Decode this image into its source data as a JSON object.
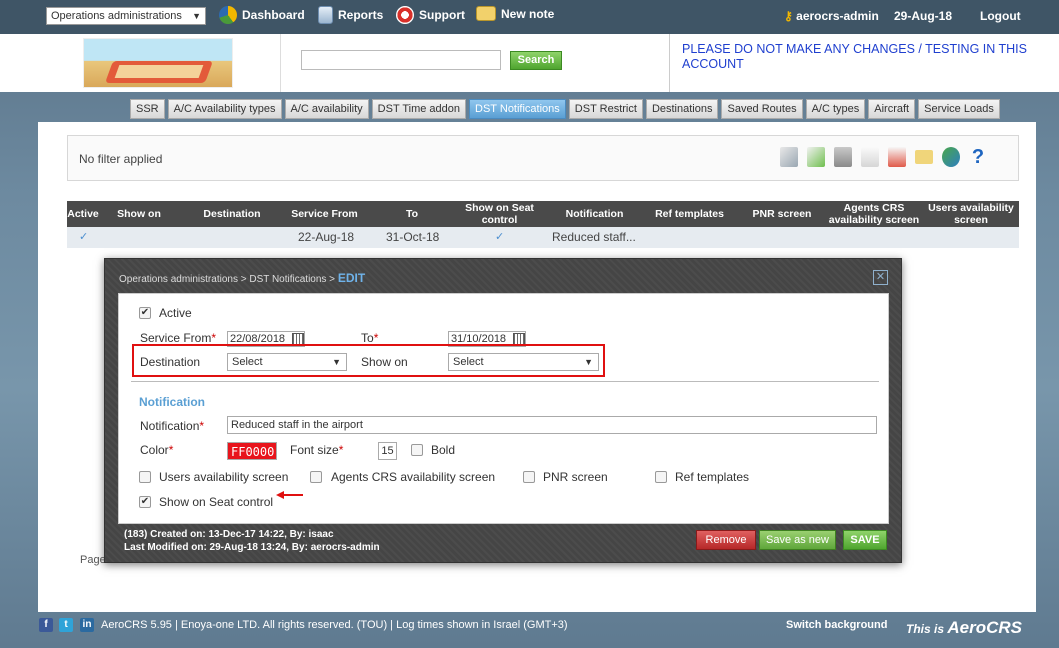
{
  "topbar": {
    "module_select": "Operations administrations",
    "dashboard": "Dashboard",
    "reports": "Reports",
    "support": "Support",
    "new_note": "New note",
    "user": "aerocrs-admin",
    "date": "29-Aug-18",
    "logout": "Logout"
  },
  "header": {
    "search_button": "Search",
    "warning": "PLEASE DO NOT MAKE ANY CHANGES / TESTING IN THIS ACCOUNT"
  },
  "tabs": [
    "SSR",
    "A/C Availability types",
    "A/C availability",
    "DST Time addon",
    "DST Notifications",
    "DST Restrict",
    "Destinations",
    "Saved Routes",
    "A/C types",
    "Aircraft",
    "Service Loads"
  ],
  "active_tab": "DST Notifications",
  "filter": {
    "text": "No filter applied",
    "help_icon": "?"
  },
  "grid": {
    "columns": [
      "Active",
      "Show on",
      "Destination",
      "Service From",
      "To",
      "Show on Seat control",
      "Notification",
      "Ref templates",
      "PNR screen",
      "Agents CRS availability screen",
      "Users availability screen"
    ],
    "rows": [
      {
        "active": "✓",
        "show_on": "",
        "destination": "",
        "service_from": "22-Aug-18",
        "to": "31-Oct-18",
        "seat_control": "✓",
        "notification": "Reduced staff..."
      }
    ]
  },
  "paging": "Page",
  "modal": {
    "breadcrumb": "Operations administrations > DST Notifications > ",
    "mode": "EDIT",
    "close": "✕",
    "active_label": "Active",
    "active_checked": "✔",
    "service_from_label": "Service From",
    "service_from_value": "22/08/2018",
    "to_label": "To",
    "to_value": "31/10/2018",
    "required_mark": "*",
    "destination_label": "Destination",
    "destination_value": "Select",
    "show_on_label": "Show on",
    "show_on_value": "Select",
    "section_title": "Notification",
    "notification_label": "Notification",
    "notification_value": "Reduced staff in the airport",
    "color_label": "Color",
    "color_value": "FF0000",
    "font_size_label": "Font size",
    "font_size_value": "15",
    "bold_label": "Bold",
    "users_avail_label": "Users availability screen",
    "agents_crs_label": "Agents CRS availability screen",
    "pnr_label": "PNR screen",
    "ref_templates_label": "Ref templates",
    "seat_control_label": "Show on Seat control",
    "seat_control_checked": "✔",
    "created": "(183) Created on: 13-Dec-17 14:22, By: isaac",
    "modified": "Last Modified on: 29-Aug-18 13:24, By: aerocrs-admin",
    "remove_button": "Remove",
    "save_as_new_button": "Save as new",
    "save_button": "SAVE"
  },
  "footer": {
    "facebook": "f",
    "twitter": "t",
    "linkedin": "in",
    "text": "AeroCRS 5.95  |  Enoya-one LTD. All rights reserved. (TOU)  |  Log times shown in Israel (GMT+3)",
    "switch_background": "Switch background",
    "this_is": "This is",
    "brand": "AeroCRS"
  },
  "colors": {
    "accent_blue": "#5a9fd3",
    "save_green": "#4fa52f",
    "remove_red": "#b62828",
    "highlight_red": "#e01010",
    "notification_color": "#FF0000"
  }
}
